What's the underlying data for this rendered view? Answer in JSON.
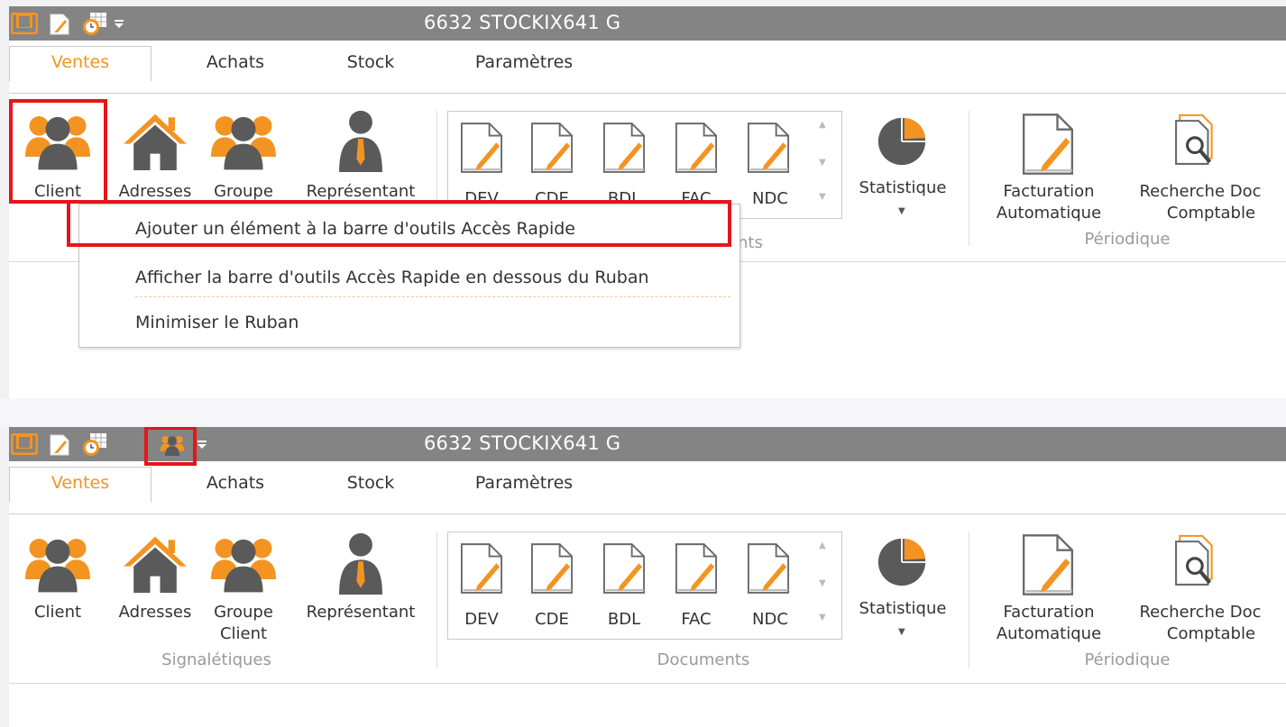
{
  "app": {
    "title": "6632 STOCKIX641 G"
  },
  "tabs": [
    "Ventes",
    "Achats",
    "Stock",
    "Paramètres"
  ],
  "signaletiques": {
    "group_label": "Signalétiques",
    "client": "Client",
    "adresses": "Adresses",
    "groupe": "Groupe",
    "groupe_client": "Client",
    "representant": "Représentant"
  },
  "documents": {
    "group_label": "Documents",
    "items": [
      "DEV",
      "CDE",
      "BDL",
      "FAC",
      "NDC"
    ],
    "partial_group_label": "nts",
    "statistique": "Statistique"
  },
  "periodique": {
    "group_label": "Périodique",
    "facturation_line1": "Facturation",
    "facturation_line2": "Automatique",
    "recherche_line1": "Recherche Doc",
    "recherche_line2": "Comptable"
  },
  "context_menu": {
    "items": [
      "Ajouter un élément à la barre d'outils Accès Rapide",
      "Afficher la barre d'outils Accès Rapide en dessous du Ruban",
      "Minimiser le Ruban"
    ]
  },
  "colors": {
    "accent": "#f39422",
    "titlebar": "#848484",
    "highlight": "#e6151a",
    "icon_gray": "#5a5a5a"
  },
  "icons": [
    "window-icon",
    "note-icon",
    "calendar-clock-icon",
    "client-icon",
    "dropdown-arrow-icon",
    "users-icon",
    "home-icon",
    "person-icon",
    "document-icon",
    "pie-chart-icon",
    "search-document-icon"
  ]
}
